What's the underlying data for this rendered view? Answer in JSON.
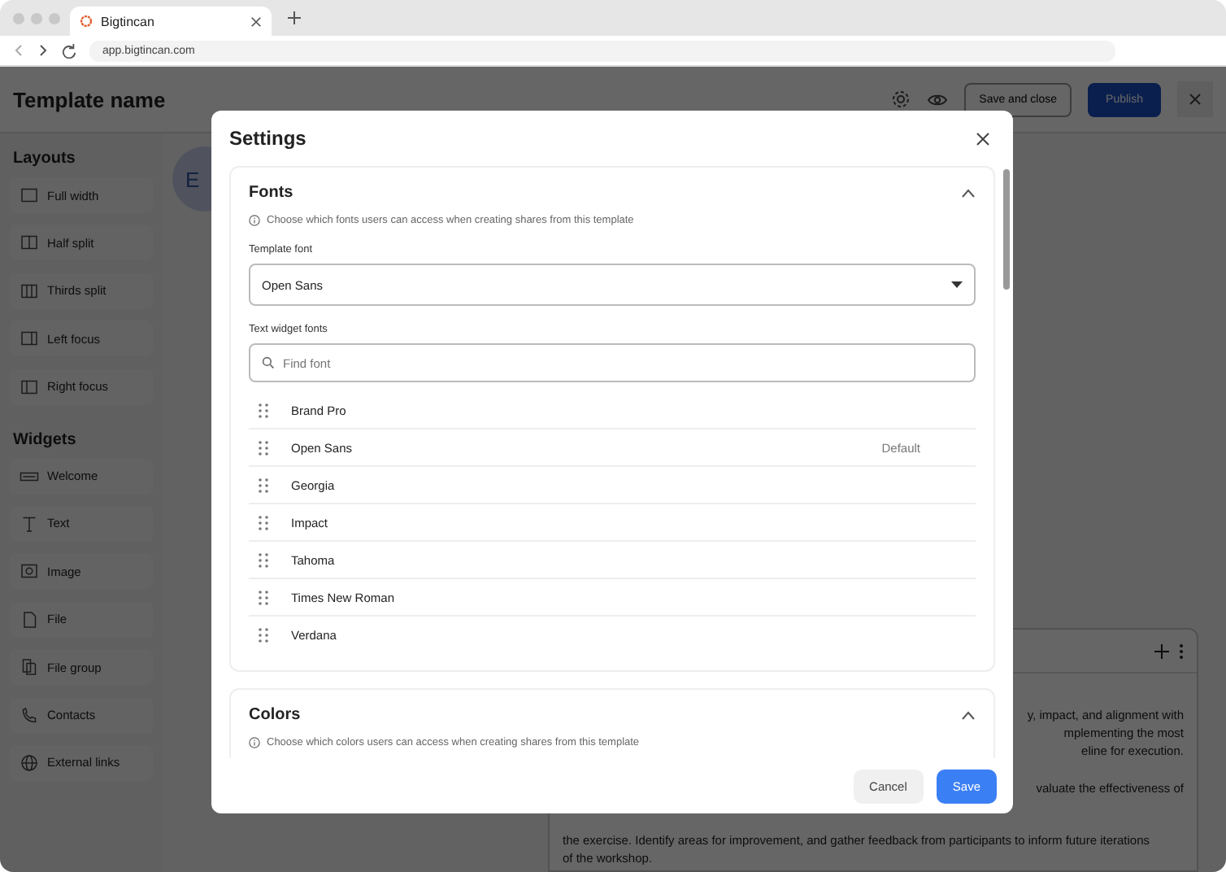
{
  "browser": {
    "tab_title": "Bigtincan",
    "url": "app.bigtincan.com"
  },
  "header": {
    "title": "Template name",
    "buttons": [
      "Save and close",
      "Publish"
    ]
  },
  "sidebar": {
    "sections": [
      {
        "title": "Layouts",
        "items": [
          {
            "label": "Full width",
            "kind": "full"
          },
          {
            "label": "Half split",
            "kind": "half"
          },
          {
            "label": "Thirds split",
            "kind": "thirds"
          },
          {
            "label": "Left focus",
            "kind": "left"
          },
          {
            "label": "Right focus",
            "kind": "right"
          }
        ]
      },
      {
        "title": "Widgets",
        "items": [
          {
            "label": "Welcome",
            "kind": "welcome"
          },
          {
            "label": "Text",
            "kind": "text"
          },
          {
            "label": "Image",
            "kind": "image"
          },
          {
            "label": "File",
            "kind": "file"
          },
          {
            "label": "File group",
            "kind": "filegroup"
          },
          {
            "label": "Contacts",
            "kind": "contacts"
          },
          {
            "label": "External links",
            "kind": "globe"
          }
        ]
      }
    ]
  },
  "canvas": {
    "avatar_letter": "E",
    "card_lines": [
      "y, impact, and alignment with",
      "mplementing the most",
      "eline for execution.",
      "valuate the effectiveness of"
    ],
    "card_bottom_lines": [
      "the exercise. Identify areas for improvement, and gather feedback from participants to inform future iterations",
      "of the workshop."
    ]
  },
  "modal": {
    "title": "Settings",
    "sections": [
      {
        "title": "Fonts",
        "expanded": true,
        "hint": "Choose which fonts users can access when creating shares from this template",
        "template_font_label": "Template font",
        "template_font": "Open Sans",
        "widget_fonts_label": "Text widget fonts",
        "search_placeholder": "Find font",
        "fonts": [
          {
            "name": "Brand Pro",
            "default": false
          },
          {
            "name": "Open Sans",
            "default": true,
            "tag": "Default"
          },
          {
            "name": "Georgia",
            "default": false
          },
          {
            "name": "Impact",
            "default": false
          },
          {
            "name": "Tahoma",
            "default": false
          },
          {
            "name": "Times New Roman",
            "default": false
          },
          {
            "name": "Verdana",
            "default": false
          }
        ]
      },
      {
        "title": "Colors",
        "expanded": true,
        "hint": "Choose which colors users can access when creating shares from this template"
      }
    ],
    "buttons": [
      "Cancel",
      "Save"
    ]
  }
}
